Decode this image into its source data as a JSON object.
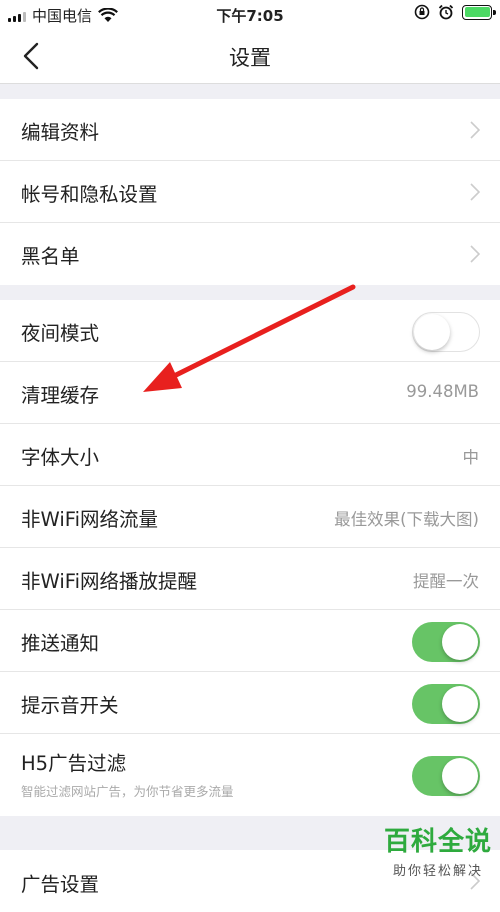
{
  "status": {
    "carrier": "中国电信",
    "time": "下午7:05"
  },
  "nav": {
    "title": "设置"
  },
  "group1": [
    {
      "label": "编辑资料"
    },
    {
      "label": "帐号和隐私设置"
    },
    {
      "label": "黑名单"
    }
  ],
  "group2": {
    "night_mode": {
      "label": "夜间模式",
      "on": false
    },
    "clear_cache": {
      "label": "清理缓存",
      "value": "99.48MB"
    },
    "font_size": {
      "label": "字体大小",
      "value": "中"
    },
    "non_wifi_traffic": {
      "label": "非WiFi网络流量",
      "value": "最佳效果(下载大图)"
    },
    "non_wifi_play": {
      "label": "非WiFi网络播放提醒",
      "value": "提醒一次"
    },
    "push": {
      "label": "推送通知",
      "on": true
    },
    "sound": {
      "label": "提示音开关",
      "on": true
    },
    "h5_filter": {
      "label": "H5广告过滤",
      "sub": "智能过滤网站广告，为你节省更多流量",
      "on": true
    }
  },
  "group3": [
    {
      "label": "广告设置"
    }
  ],
  "watermark": {
    "title": "百科全说",
    "subtitle": "助你轻松解决"
  },
  "colors": {
    "toggle_on": "#67c466",
    "arrow": "#e8201e",
    "watermark": "#2eaa3e",
    "background": "#efeff4"
  }
}
